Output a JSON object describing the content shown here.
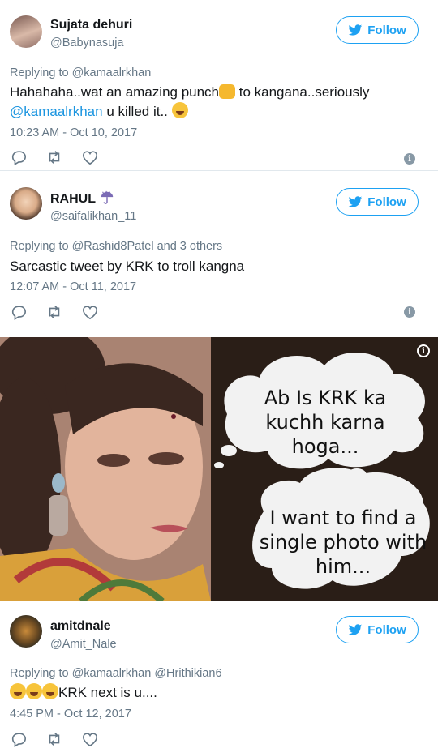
{
  "tweets": [
    {
      "name": "Sujata dehuri",
      "handle": "@Babynasuja",
      "follow_label": "Follow",
      "replying": "Replying to @kamaalrkhan",
      "text_part1": "Hahahaha..wat an amazing punch",
      "text_part2": " to kangana..seriously",
      "mention": "@kamaalrkhan",
      "text_part3": " u killed it.. ",
      "timestamp": "10:23 AM - Oct 10, 2017"
    },
    {
      "name": "RAHUL",
      "handle": "@saifalikhan_11",
      "follow_label": "Follow",
      "replying": "Replying to @Rashid8Patel and 3 others",
      "text": "Sarcastic tweet by KRK to troll kangna",
      "timestamp": "12:07 AM - Oct 11, 2017"
    },
    {
      "name": "amitdnale",
      "handle": "@Amit_Nale",
      "follow_label": "Follow",
      "replying": "Replying to @kamaalrkhan @Hrithikian6",
      "text": "KRK next is u....",
      "timestamp": "4:45 PM - Oct 12, 2017"
    }
  ],
  "meme": {
    "bubble1": "Ab Is KRK ka kuchh karna hoga...",
    "bubble2": "I want to find a single photo with him..."
  },
  "colors": {
    "accent": "#1da1f2",
    "mention": "#1b95e0",
    "muted": "#657786"
  }
}
